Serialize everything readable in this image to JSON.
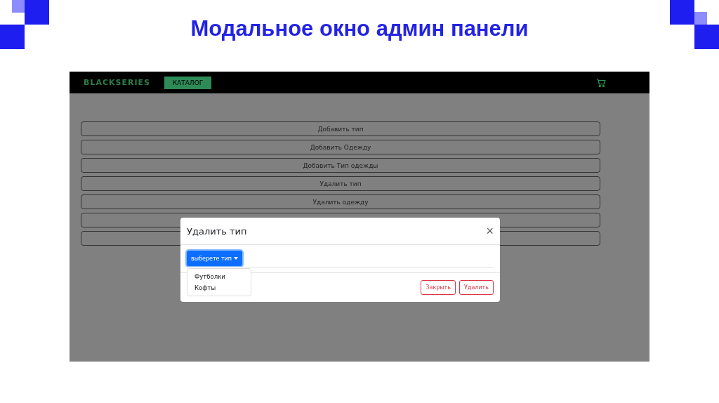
{
  "slide": {
    "title": "Модальное окно админ панели"
  },
  "navbar": {
    "brand": "BLACKSERIES",
    "catalog_button": "КАТАЛОГ"
  },
  "admin_buttons": [
    {
      "kind": "labeled",
      "label": "Добавить тип"
    },
    {
      "kind": "labeled",
      "label": "Добавить Одежду"
    },
    {
      "kind": "labeled",
      "label": "Добавить Тип одежды"
    },
    {
      "kind": "labeled",
      "label": "Удалить тип"
    },
    {
      "kind": "labeled",
      "label": "Удалить одежду"
    },
    {
      "kind": "covered"
    },
    {
      "kind": "covered"
    }
  ],
  "modal": {
    "title": "Удалить тип",
    "close": "×",
    "dropdown": {
      "label": "выберете тип",
      "expanded": true,
      "options": [
        "Футболки",
        "Кофты"
      ]
    },
    "buttons": [
      "Закрыть",
      "Удалить"
    ]
  }
}
